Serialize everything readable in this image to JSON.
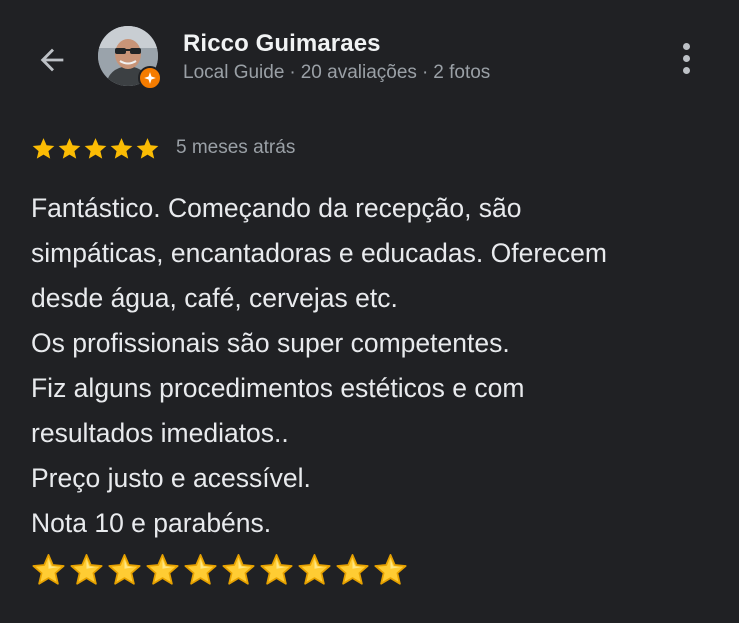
{
  "header": {
    "name": "Ricco Guimaraes",
    "meta": [
      "Local Guide",
      "20 avaliações",
      "2 fotos"
    ],
    "separator": "·"
  },
  "review": {
    "rating": 5,
    "rating_max": 5,
    "time": "5 meses atrás",
    "lines": [
      "Fantástico. Começando da recepção, são",
      "simpáticas, encantadoras e educadas. Oferecem",
      "desde água, café, cervejas etc.",
      "Os profissionais são super competentes.",
      "Fiz alguns procedimentos estéticos e com",
      "resultados imediatos..",
      "Preço justo e acessível.",
      "Nota 10 e parabéns."
    ],
    "emoji_star_count": 10
  },
  "icons": {
    "back": "arrow-back-icon",
    "more": "more-vert-icon",
    "badge": "local-guide-badge-icon",
    "star": "star-icon",
    "emoji_star": "star-emoji-icon"
  },
  "colors": {
    "background": "#202124",
    "star": "#fbbc04",
    "badge": "#f57c00",
    "secondary_text": "#9aa0a6"
  }
}
